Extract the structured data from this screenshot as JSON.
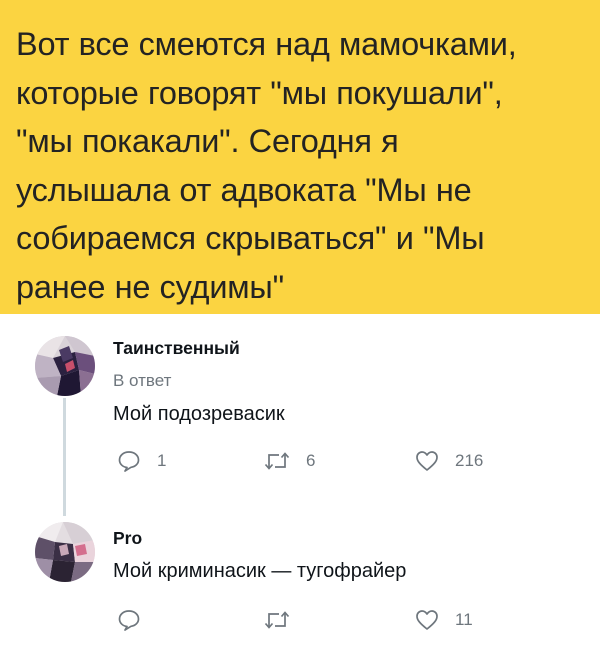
{
  "post": {
    "lines": [
      "Вот все смеются над мамочками,",
      "которые говорят \"мы покушали\",",
      "\"мы покакали\". Сегодня я",
      "услышала от адвоката \"Мы не",
      "собираемся скрываться\" и \"Мы",
      "ранее не судимы\""
    ],
    "background": "#fbd441"
  },
  "comments": [
    {
      "author": "Таинственный",
      "reply_label": "В ответ",
      "text": "Мой подозревасик",
      "replies": "1",
      "retweets": "6",
      "likes": "216"
    },
    {
      "author": "Pro",
      "text": "Мой криминасик — тугофрайер",
      "replies": "",
      "retweets": "",
      "likes": "11"
    }
  ],
  "icons": {
    "reply": "reply-bubble-icon",
    "retweet": "retweet-arrows-icon",
    "like": "heart-outline-icon"
  }
}
